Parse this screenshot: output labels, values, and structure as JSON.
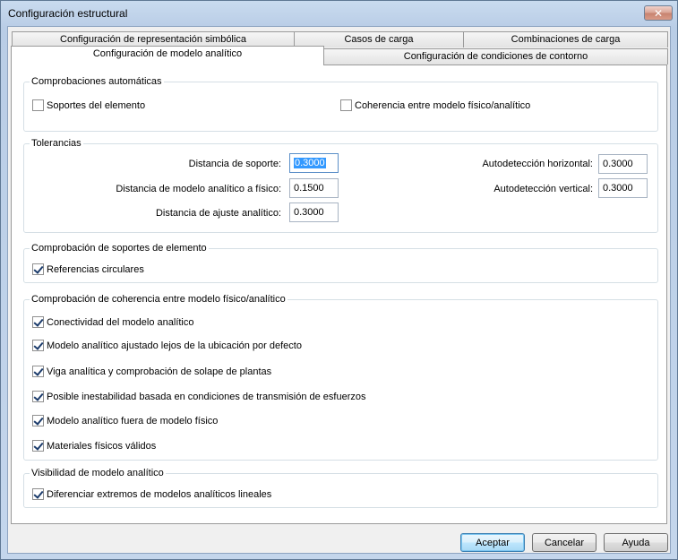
{
  "window": {
    "title": "Configuración estructural",
    "close_label": "✕"
  },
  "tabs": {
    "row_back": [
      "Configuración de representación simbólica",
      "Casos de carga",
      "Combinaciones de carga"
    ],
    "row_front": [
      "Configuración de modelo analítico",
      "Configuración de condiciones de contorno"
    ],
    "active": "Configuración de modelo analítico"
  },
  "auto_checks": {
    "legend": "Comprobaciones automáticas",
    "items": [
      {
        "label": "Soportes del elemento",
        "checked": false
      },
      {
        "label": "Coherencia entre modelo físico/analítico",
        "checked": false
      }
    ]
  },
  "tolerances": {
    "legend": "Tolerancias",
    "support_distance": {
      "label": "Distancia de soporte:",
      "value": "0.3000"
    },
    "analytical_to_physical": {
      "label": "Distancia de modelo analítico a físico:",
      "value": "0.1500"
    },
    "analytical_adjust": {
      "label": "Distancia de ajuste analítico:",
      "value": "0.3000"
    },
    "auto_horizontal": {
      "label": "Autodetección horizontal:",
      "value": "0.3000"
    },
    "auto_vertical": {
      "label": "Autodetección vertical:",
      "value": "0.3000"
    }
  },
  "support_checks": {
    "legend": "Comprobación de soportes de elemento",
    "items": [
      {
        "label": "Referencias circulares",
        "checked": true
      }
    ]
  },
  "consistency_checks": {
    "legend": "Comprobación de coherencia entre modelo físico/analítico",
    "items": [
      {
        "label": "Conectividad del modelo analítico",
        "checked": true
      },
      {
        "label": "Modelo analítico ajustado lejos de la ubicación por defecto",
        "checked": true
      },
      {
        "label": "Viga analítica y comprobación de solape de plantas",
        "checked": true
      },
      {
        "label": "Posible inestabilidad basada en condiciones de transmisión de esfuerzos",
        "checked": true
      },
      {
        "label": "Modelo analítico fuera de modelo físico",
        "checked": true
      },
      {
        "label": "Materiales físicos válidos",
        "checked": true
      }
    ]
  },
  "visibility": {
    "legend": "Visibilidad de modelo analítico",
    "items": [
      {
        "label": "Diferenciar extremos de modelos analíticos lineales",
        "checked": true
      }
    ]
  },
  "buttons": {
    "ok": "Aceptar",
    "cancel": "Cancelar",
    "help": "Ayuda"
  }
}
